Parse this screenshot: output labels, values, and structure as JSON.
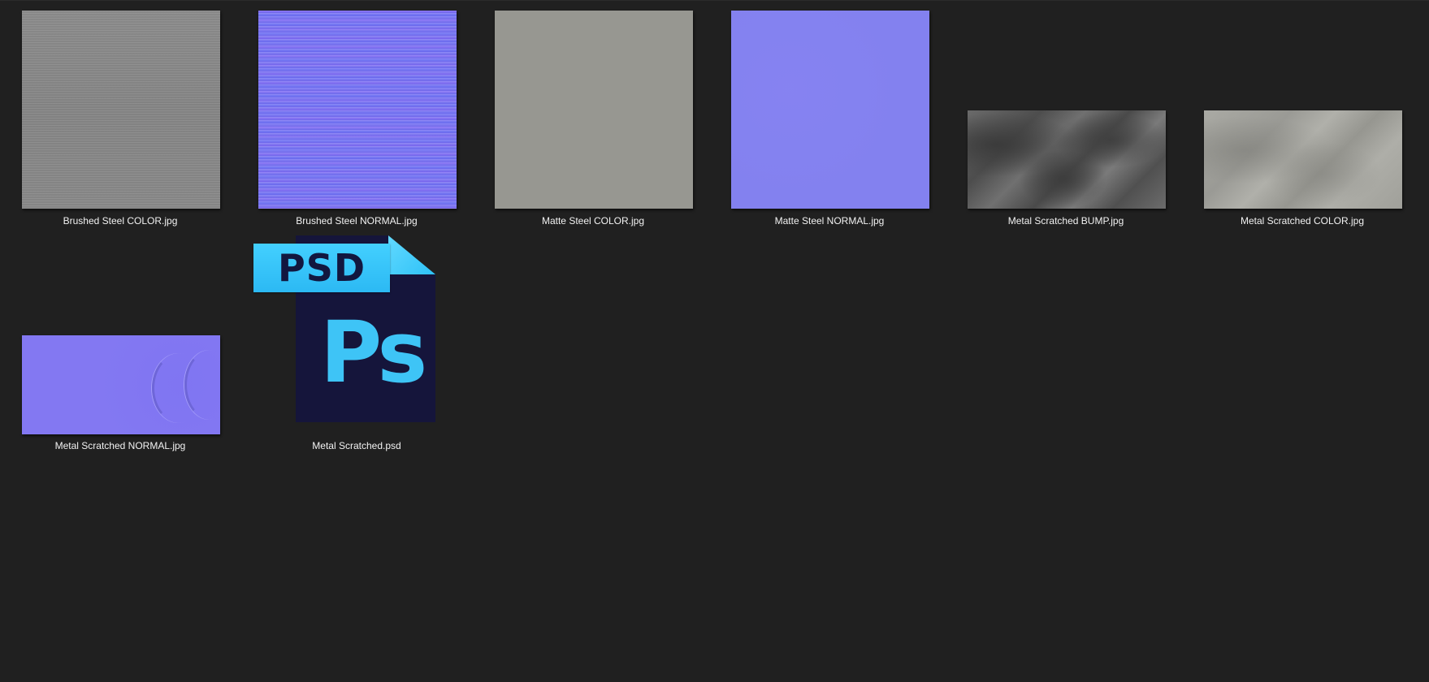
{
  "files": [
    {
      "name": "Brushed Steel COLOR.jpg"
    },
    {
      "name": "Brushed Steel NORMAL.jpg"
    },
    {
      "name": "Matte Steel COLOR.jpg"
    },
    {
      "name": "Matte Steel NORMAL.jpg"
    },
    {
      "name": "Metal Scratched BUMP.jpg"
    },
    {
      "name": "Metal Scratched COLOR.jpg"
    },
    {
      "name": "Metal Scratched NORMAL.jpg"
    },
    {
      "name": "Metal Scratched.psd",
      "icon": "photoshop-file-icon",
      "badge_text": "PSD",
      "icon_text": "Ps"
    }
  ],
  "colors": {
    "background": "#202020",
    "label_text": "#f2f2f2",
    "psd_dark": "#15153b",
    "psd_accent": "#3ec4f6"
  }
}
